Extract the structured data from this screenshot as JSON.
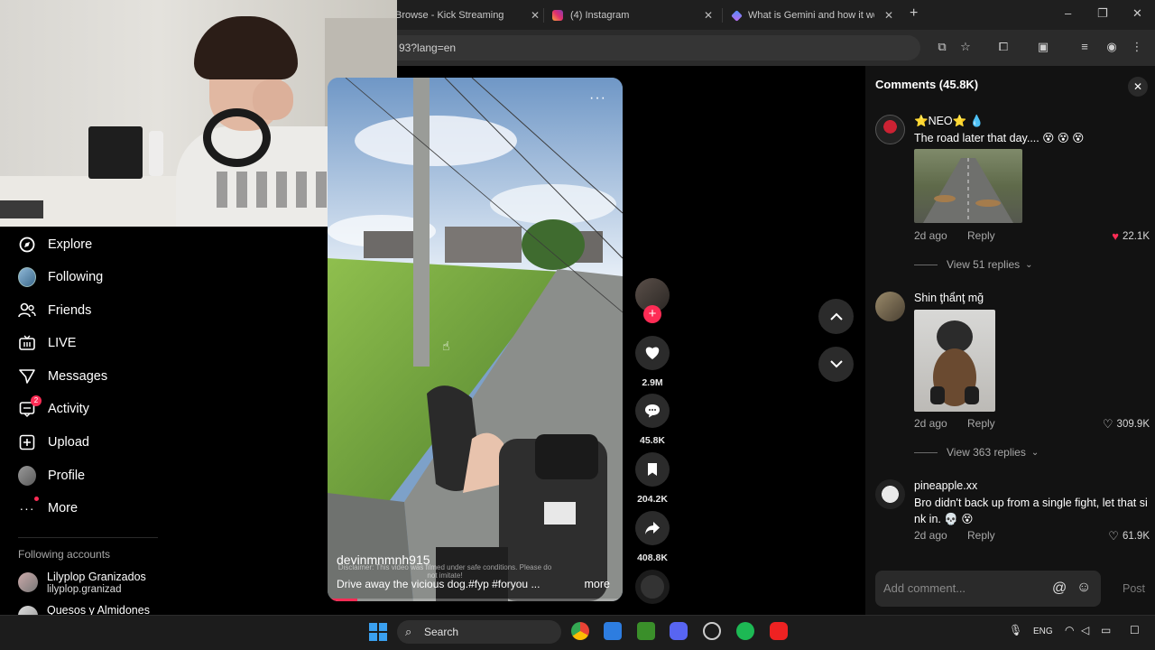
{
  "browser": {
    "tabs": [
      {
        "title": "Browse - Kick Streaming"
      },
      {
        "title": "(4) Instagram"
      },
      {
        "title": "What is Gemini and how it work"
      }
    ],
    "new_tab": "+",
    "url": "93?lang=en",
    "window_controls": {
      "minimize": "–",
      "maximize": "❐",
      "close": "✕"
    }
  },
  "nav": {
    "items": [
      {
        "label": "Explore",
        "icon": "compass-icon"
      },
      {
        "label": "Following",
        "icon": "following-avatar-icon"
      },
      {
        "label": "Friends",
        "icon": "friends-icon"
      },
      {
        "label": "LIVE",
        "icon": "live-tv-icon"
      },
      {
        "label": "Messages",
        "icon": "messages-icon"
      },
      {
        "label": "Activity",
        "icon": "activity-icon",
        "badge": "2"
      },
      {
        "label": "Upload",
        "icon": "upload-icon"
      },
      {
        "label": "Profile",
        "icon": "profile-avatar-icon"
      },
      {
        "label": "More",
        "icon": "more-dots-icon"
      }
    ],
    "following_accounts_title": "Following accounts",
    "accounts": [
      {
        "name": "Lilyplop Granizados",
        "handle": "lilyplop.granizad"
      },
      {
        "name": "Quesos y Almidones",
        "handle": ""
      }
    ]
  },
  "video": {
    "author": "devinmnmnh915",
    "caption": "Drive away the vicious dog.#fyp #foryou ...",
    "disclaimer": "Disclaimer: This video was filmed under safe conditions. Please do not imitate!",
    "more_label": "more",
    "progress": 0.1
  },
  "actions": {
    "likes": "2.9M",
    "comments": "45.8K",
    "saves": "204.2K",
    "shares": "408.8K"
  },
  "comments_panel": {
    "title": "Comments (45.8K)",
    "add_placeholder": "Add comment...",
    "post_label": "Post",
    "comments": [
      {
        "user": "⭐NEO⭐ 💧",
        "text": "The road later that day.... 😵 😵 😵",
        "time": "2d ago",
        "reply": "Reply",
        "likes": "22.1K",
        "liked": true,
        "view_replies": "View 51 replies"
      },
      {
        "user": "Shin ţhẩnţ mğ",
        "text": "",
        "time": "2d ago",
        "reply": "Reply",
        "likes": "309.9K",
        "liked": false,
        "view_replies": "View 363 replies"
      },
      {
        "user": "pineapple.xx",
        "text": "Bro didn't back up from a single fight, let that sink in. 💀 😵",
        "time": "2d ago",
        "reply": "Reply",
        "likes": "61.9K",
        "liked": false,
        "view_replies": ""
      }
    ]
  },
  "taskbar": {
    "search_label": "Search",
    "language": "ENG"
  },
  "colors": {
    "accent": "#fe2c55",
    "panel_bg": "#121212",
    "chrome_bg": "#1f1f1f"
  }
}
